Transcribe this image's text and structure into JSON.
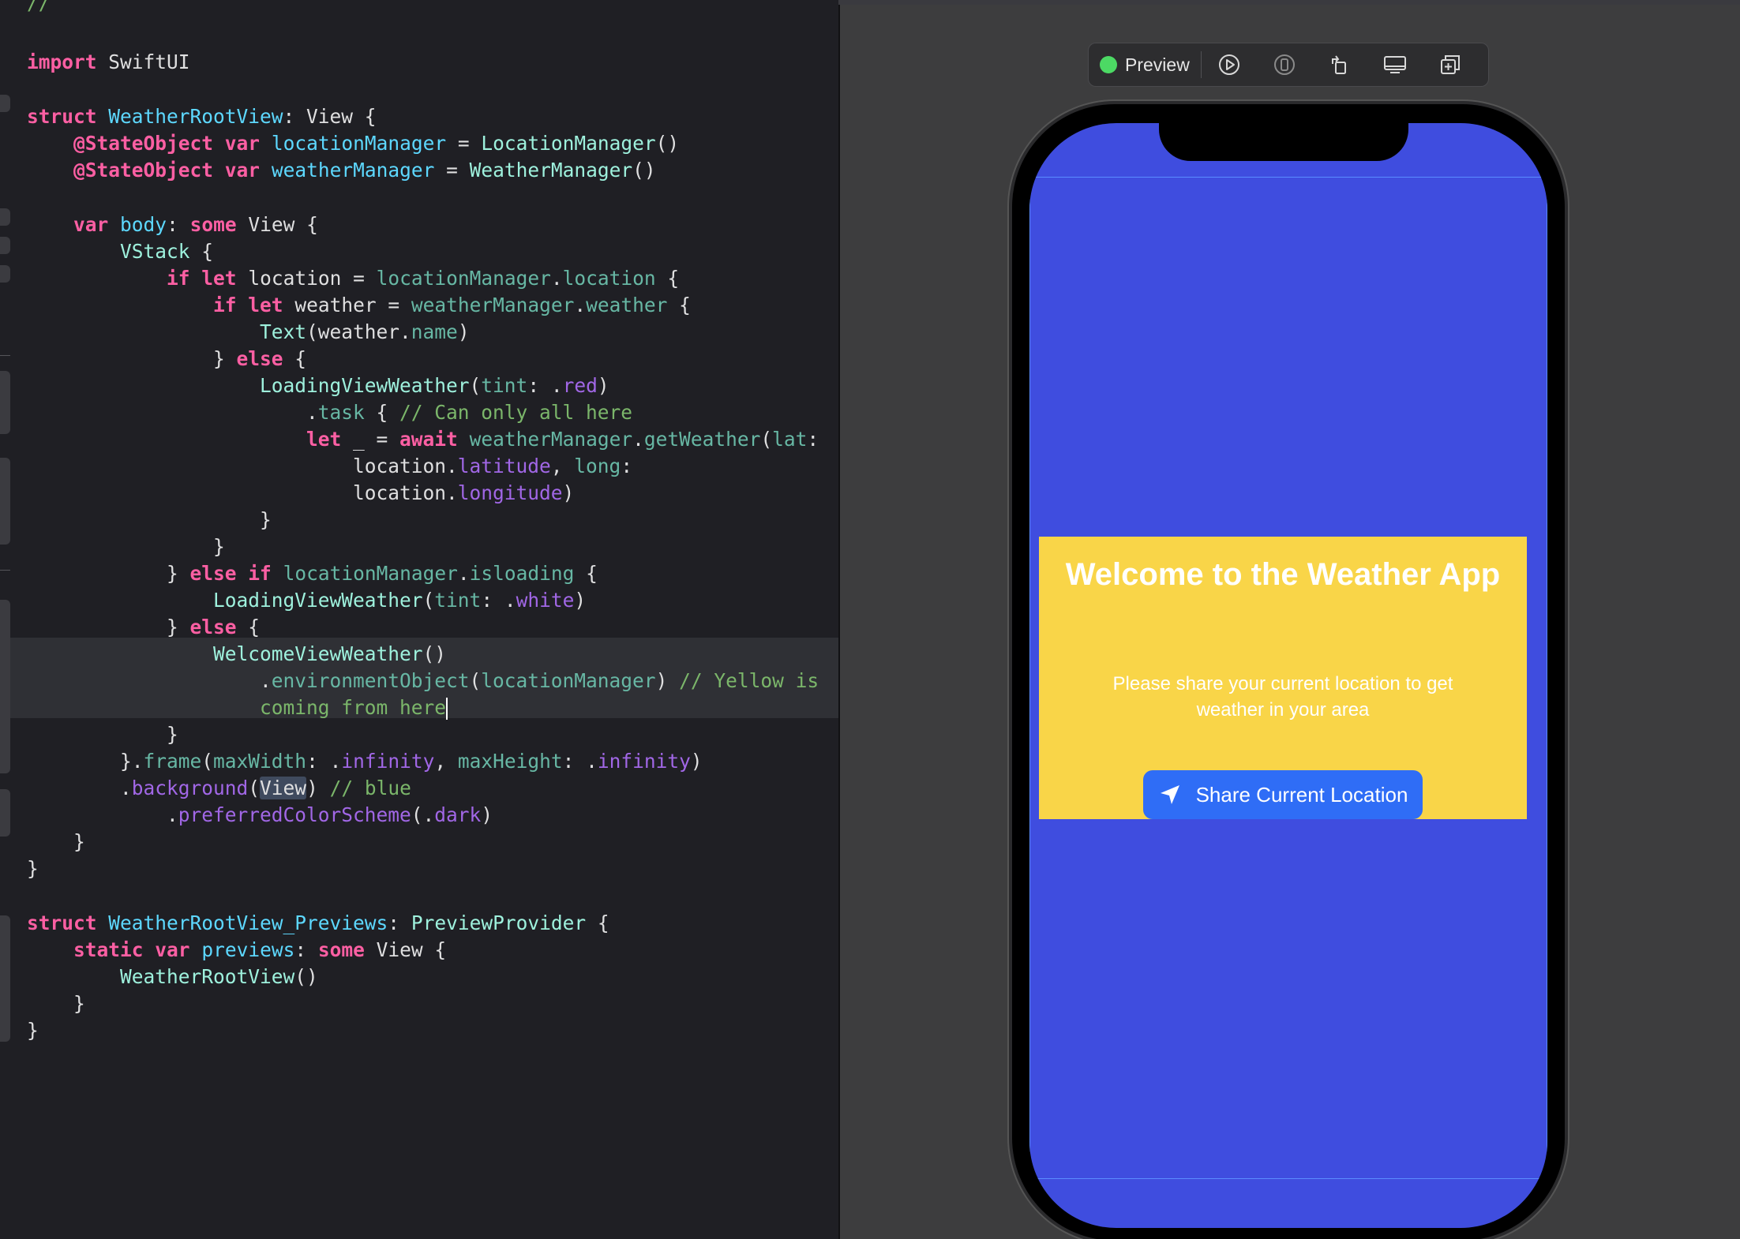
{
  "editor": {
    "lines": [
      [
        [
          "cm",
          "//"
        ]
      ],
      [
        [
          "kw",
          "import"
        ],
        [
          "pl",
          " SwiftUI"
        ]
      ],
      [
        [
          "kw",
          "struct"
        ],
        [
          "pl",
          " "
        ],
        [
          "ty",
          "WeatherRootView"
        ],
        [
          "pl",
          ": View {"
        ]
      ],
      [
        [
          "pl",
          "    "
        ],
        [
          "kw",
          "@StateObject"
        ],
        [
          "pl",
          " "
        ],
        [
          "kw",
          "var"
        ],
        [
          "pl",
          " "
        ],
        [
          "ty",
          "locationManager"
        ],
        [
          "pl",
          " = "
        ],
        [
          "id",
          "LocationManager"
        ],
        [
          "pl",
          "()"
        ]
      ],
      [
        [
          "pl",
          "    "
        ],
        [
          "kw",
          "@StateObject"
        ],
        [
          "pl",
          " "
        ],
        [
          "kw",
          "var"
        ],
        [
          "pl",
          " "
        ],
        [
          "ty",
          "weatherManager"
        ],
        [
          "pl",
          " = "
        ],
        [
          "id",
          "WeatherManager"
        ],
        [
          "pl",
          "()"
        ]
      ],
      [
        [
          "pl",
          "    "
        ],
        [
          "kw",
          "var"
        ],
        [
          "pl",
          " "
        ],
        [
          "ty",
          "body"
        ],
        [
          "pl",
          ": "
        ],
        [
          "kw",
          "some"
        ],
        [
          "pl",
          " View {"
        ]
      ],
      [
        [
          "pl",
          "        "
        ],
        [
          "id",
          "VStack"
        ],
        [
          "pl",
          " {"
        ]
      ],
      [
        [
          "pl",
          "            "
        ],
        [
          "kw",
          "if"
        ],
        [
          "pl",
          " "
        ],
        [
          "kw",
          "let"
        ],
        [
          "pl",
          " location = "
        ],
        [
          "pr",
          "locationManager"
        ],
        [
          "pl",
          "."
        ],
        [
          "pr",
          "location"
        ],
        [
          "pl",
          " {"
        ]
      ],
      [
        [
          "pl",
          "                "
        ],
        [
          "kw",
          "if"
        ],
        [
          "pl",
          " "
        ],
        [
          "kw",
          "let"
        ],
        [
          "pl",
          " weather = "
        ],
        [
          "pr",
          "weatherManager"
        ],
        [
          "pl",
          "."
        ],
        [
          "pr",
          "weather"
        ],
        [
          "pl",
          " {"
        ]
      ],
      [
        [
          "pl",
          "                    "
        ],
        [
          "id",
          "Text"
        ],
        [
          "pl",
          "(weather."
        ],
        [
          "pr",
          "name"
        ],
        [
          "pl",
          ")"
        ]
      ],
      [
        [
          "pl",
          "                } "
        ],
        [
          "kw",
          "else"
        ],
        [
          "pl",
          " {"
        ]
      ],
      [
        [
          "pl",
          "                    "
        ],
        [
          "id",
          "LoadingViewWeather"
        ],
        [
          "pl",
          "("
        ],
        [
          "pr",
          "tint"
        ],
        [
          "pl",
          ": ."
        ],
        [
          "fn",
          "red"
        ],
        [
          "pl",
          ")"
        ]
      ],
      [
        [
          "pl",
          "                        ."
        ],
        [
          "pr",
          "task"
        ],
        [
          "pl",
          " { "
        ],
        [
          "cm",
          "// Can only all here"
        ]
      ],
      [
        [
          "pl",
          "                        "
        ],
        [
          "kw",
          "let"
        ],
        [
          "pl",
          " _ = "
        ],
        [
          "kw",
          "await"
        ],
        [
          "pl",
          " "
        ],
        [
          "pr",
          "weatherManager"
        ],
        [
          "pl",
          "."
        ],
        [
          "pr",
          "getWeather"
        ],
        [
          "pl",
          "("
        ],
        [
          "pr",
          "lat"
        ],
        [
          "pl",
          ":"
        ]
      ],
      [
        [
          "pl",
          "                            location."
        ],
        [
          "fn",
          "latitude"
        ],
        [
          "pl",
          ", "
        ],
        [
          "pr",
          "long"
        ],
        [
          "pl",
          ":"
        ]
      ],
      [
        [
          "pl",
          "                            location."
        ],
        [
          "fn",
          "longitude"
        ],
        [
          "pl",
          ")"
        ]
      ],
      [
        [
          "pl",
          "                    }"
        ]
      ],
      [
        [
          "pl",
          "                }"
        ]
      ],
      [
        [
          "pl",
          "            } "
        ],
        [
          "kw",
          "else"
        ],
        [
          "pl",
          " "
        ],
        [
          "kw",
          "if"
        ],
        [
          "pl",
          " "
        ],
        [
          "pr",
          "locationManager"
        ],
        [
          "pl",
          "."
        ],
        [
          "pr",
          "isloading"
        ],
        [
          "pl",
          " {"
        ]
      ],
      [
        [
          "pl",
          "                "
        ],
        [
          "id",
          "LoadingViewWeather"
        ],
        [
          "pl",
          "("
        ],
        [
          "pr",
          "tint"
        ],
        [
          "pl",
          ": ."
        ],
        [
          "fn",
          "white"
        ],
        [
          "pl",
          ")"
        ]
      ],
      [
        [
          "pl",
          "            } "
        ],
        [
          "kw",
          "else"
        ],
        [
          "pl",
          " {"
        ]
      ],
      [
        [
          "pl",
          "                "
        ],
        [
          "id",
          "WelcomeViewWeather"
        ],
        [
          "pl",
          "()"
        ]
      ],
      [
        [
          "pl",
          "                    ."
        ],
        [
          "pr",
          "environmentObject"
        ],
        [
          "pl",
          "("
        ],
        [
          "pr",
          "locationManager"
        ],
        [
          "pl",
          ") "
        ],
        [
          "cm",
          "// Yellow is"
        ]
      ],
      [
        [
          "pl",
          "                    "
        ],
        [
          "cm",
          "coming from here"
        ]
      ],
      [
        [
          "pl",
          "            }"
        ]
      ],
      [
        [
          "pl",
          "        }."
        ],
        [
          "pr",
          "frame"
        ],
        [
          "pl",
          "("
        ],
        [
          "pr",
          "maxWidth"
        ],
        [
          "pl",
          ": ."
        ],
        [
          "fn",
          "infinity"
        ],
        [
          "pl",
          ", "
        ],
        [
          "pr",
          "maxHeight"
        ],
        [
          "pl",
          ": ."
        ],
        [
          "fn",
          "infinity"
        ],
        [
          "pl",
          ")"
        ]
      ],
      [
        [
          "pl",
          "        ."
        ],
        [
          "fn",
          "background"
        ],
        [
          "pl",
          "("
        ],
        [
          "sel",
          "View"
        ],
        [
          "pl",
          ") "
        ],
        [
          "cm",
          "// blue"
        ]
      ],
      [
        [
          "pl",
          "            ."
        ],
        [
          "fn",
          "preferredColorScheme"
        ],
        [
          "pl",
          "(."
        ],
        [
          "fn",
          "dark"
        ],
        [
          "pl",
          ")"
        ]
      ],
      [
        [
          "pl",
          "    }"
        ]
      ],
      [
        [
          "pl",
          "}"
        ]
      ],
      [
        [
          "kw",
          "struct"
        ],
        [
          "pl",
          " "
        ],
        [
          "ty",
          "WeatherRootView_Previews"
        ],
        [
          "pl",
          ": "
        ],
        [
          "id",
          "PreviewProvider"
        ],
        [
          "pl",
          " {"
        ]
      ],
      [
        [
          "pl",
          "    "
        ],
        [
          "kw",
          "static"
        ],
        [
          "pl",
          " "
        ],
        [
          "kw",
          "var"
        ],
        [
          "pl",
          " "
        ],
        [
          "ty",
          "previews"
        ],
        [
          "pl",
          ": "
        ],
        [
          "kw",
          "some"
        ],
        [
          "pl",
          " View {"
        ]
      ],
      [
        [
          "pl",
          "        "
        ],
        [
          "id",
          "WeatherRootView"
        ],
        [
          "pl",
          "()"
        ]
      ],
      [
        [
          "pl",
          "    }"
        ]
      ],
      [
        [
          "pl",
          "}"
        ]
      ]
    ]
  },
  "toolbar": {
    "preview_label": "Preview",
    "buttons": [
      "play-icon",
      "device-icon",
      "rotate-icon",
      "display-icon",
      "duplicate-icon"
    ]
  },
  "welcome": {
    "title": "Welcome to the Weather App",
    "subtitle": "Please share your current location to get weather in your area",
    "button_label": "Share Current Location"
  },
  "colors": {
    "screen_bg": "#3f4ddf",
    "card_bg": "#f9d548",
    "button_bg": "#2f6df6",
    "status_green": "#4cd964"
  }
}
